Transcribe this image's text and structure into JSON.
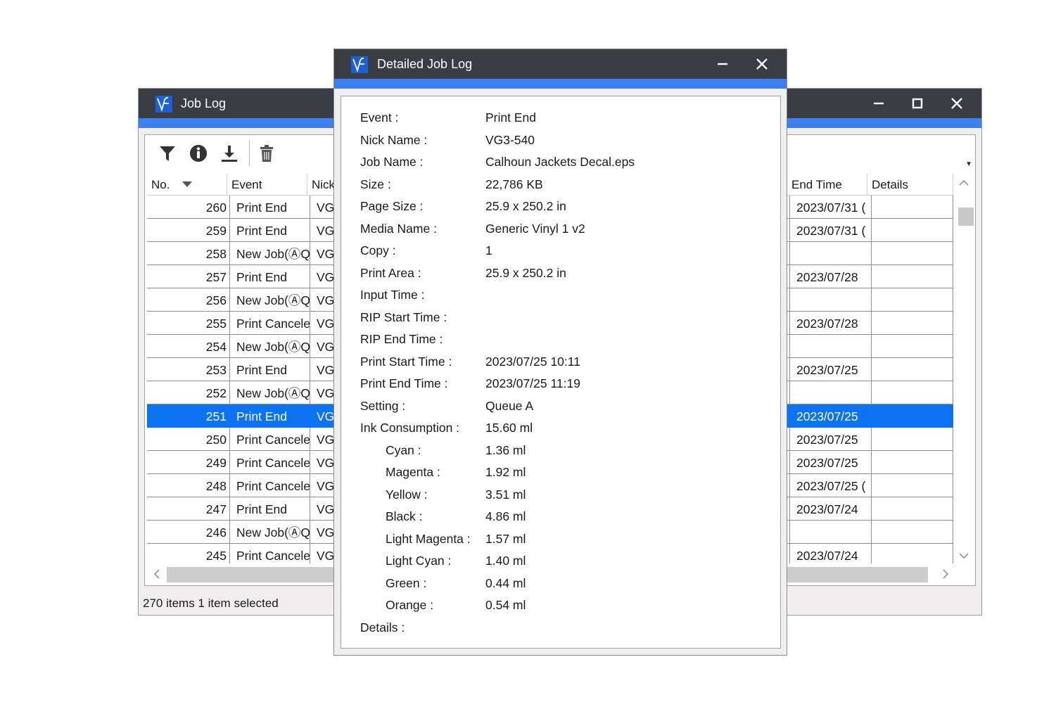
{
  "joblog": {
    "title": "Job Log",
    "toolbar": [
      "filter-icon",
      "info-icon",
      "download-icon",
      "delete-icon"
    ],
    "columns": {
      "no": "No.",
      "event": "Event",
      "nick": "Nick",
      "end": "End Time",
      "details": "Details"
    },
    "rows": [
      {
        "no": "260",
        "event": "Print End",
        "nick": "VG",
        "end": "2023/07/31 (",
        "details": ""
      },
      {
        "no": "259",
        "event": "Print End",
        "nick": "VG",
        "end": "2023/07/31 (",
        "details": ""
      },
      {
        "no": "258",
        "event": "New Job(ⒶQ",
        "nick": "VG",
        "end": "",
        "details": ""
      },
      {
        "no": "257",
        "event": "Print End",
        "nick": "VG",
        "end": "2023/07/28",
        "details": ""
      },
      {
        "no": "256",
        "event": "New Job(ⒶQ",
        "nick": "VG",
        "end": "",
        "details": ""
      },
      {
        "no": "255",
        "event": "Print Cancele",
        "nick": "VG",
        "end": "2023/07/28",
        "details": ""
      },
      {
        "no": "254",
        "event": "New Job(ⒶQ",
        "nick": "VG",
        "end": "",
        "details": ""
      },
      {
        "no": "253",
        "event": "Print End",
        "nick": "VG",
        "end": "2023/07/25",
        "details": ""
      },
      {
        "no": "252",
        "event": "New Job(ⒶQ",
        "nick": "VG",
        "end": "",
        "details": ""
      },
      {
        "no": "251",
        "event": "Print End",
        "nick": "VG",
        "end": "2023/07/25",
        "details": ""
      },
      {
        "no": "250",
        "event": "Print Cancele",
        "nick": "VG",
        "end": "2023/07/25",
        "details": ""
      },
      {
        "no": "249",
        "event": "Print Cancele",
        "nick": "VG",
        "end": "2023/07/25",
        "details": ""
      },
      {
        "no": "248",
        "event": "Print Cancele",
        "nick": "VG",
        "end": "2023/07/25 (",
        "details": ""
      },
      {
        "no": "247",
        "event": "Print End",
        "nick": "VG",
        "end": "2023/07/24",
        "details": ""
      },
      {
        "no": "246",
        "event": "New Job(ⒶQ",
        "nick": "VG",
        "end": "",
        "details": ""
      },
      {
        "no": "245",
        "event": "Print Cancele",
        "nick": "VG",
        "end": "2023/07/24",
        "details": ""
      }
    ],
    "selected_no": "251",
    "status": "270 items 1 item selected"
  },
  "detail": {
    "title": "Detailed Job Log",
    "fields": [
      {
        "label": "Event :",
        "value": "Print End",
        "indent": false
      },
      {
        "label": "Nick Name :",
        "value": "VG3-540",
        "indent": false
      },
      {
        "label": "Job Name :",
        "value": "Calhoun Jackets Decal.eps",
        "indent": false
      },
      {
        "label": "Size :",
        "value": "22,786 KB",
        "indent": false
      },
      {
        "label": "Page Size :",
        "value": "25.9 x 250.2 in",
        "indent": false
      },
      {
        "label": "Media Name :",
        "value": "Generic Vinyl 1 v2",
        "indent": false
      },
      {
        "label": "Copy :",
        "value": "1",
        "indent": false
      },
      {
        "label": "Print Area :",
        "value": "25.9 x 250.2 in",
        "indent": false
      },
      {
        "label": "Input Time :",
        "value": "",
        "indent": false
      },
      {
        "label": "RIP Start Time :",
        "value": "",
        "indent": false
      },
      {
        "label": "RIP End Time :",
        "value": "",
        "indent": false
      },
      {
        "label": "Print Start Time :",
        "value": "2023/07/25 10:11",
        "indent": false
      },
      {
        "label": "Print End Time :",
        "value": "2023/07/25 11:19",
        "indent": false
      },
      {
        "label": "Setting :",
        "value": "Queue A",
        "indent": false
      },
      {
        "label": "Ink Consumption :",
        "value": "15.60 ml",
        "indent": false
      },
      {
        "label": "Cyan :",
        "value": "1.36 ml",
        "indent": true
      },
      {
        "label": "Magenta :",
        "value": "1.92 ml",
        "indent": true
      },
      {
        "label": "Yellow :",
        "value": "3.51 ml",
        "indent": true
      },
      {
        "label": "Black :",
        "value": "4.86 ml",
        "indent": true
      },
      {
        "label": "Light Magenta :",
        "value": "1.57 ml",
        "indent": true
      },
      {
        "label": "Light Cyan :",
        "value": "1.40 ml",
        "indent": true
      },
      {
        "label": "Green :",
        "value": "0.44 ml",
        "indent": true
      },
      {
        "label": "Orange :",
        "value": "0.54 ml",
        "indent": true
      },
      {
        "label": "Details :",
        "value": "",
        "indent": false
      }
    ]
  },
  "colors": {
    "titlebar": "#3a3d44",
    "accent": "#3b7ff0",
    "selection": "#0b73f3"
  }
}
